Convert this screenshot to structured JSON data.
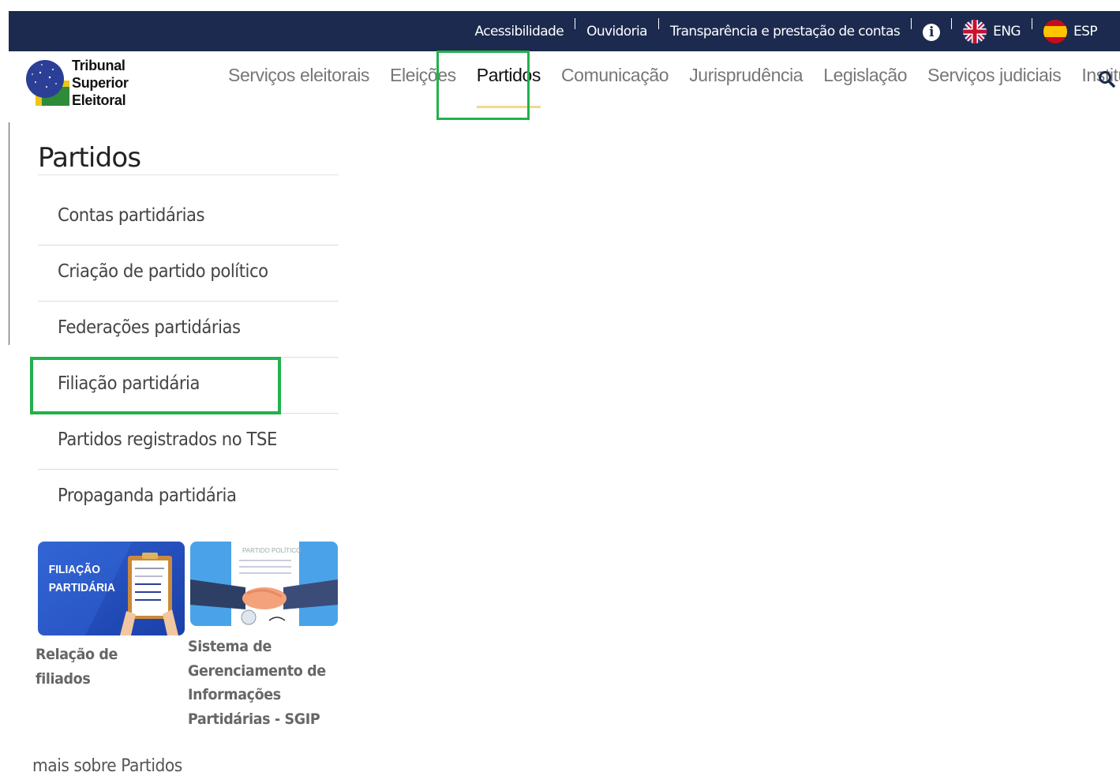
{
  "topbar": {
    "links": [
      "Acessibilidade",
      "Ouvidoria",
      "Transparência e prestação de contas"
    ],
    "info_icon": "info-icon",
    "languages": [
      {
        "label": "ENG",
        "icon": "uk-flag-icon"
      },
      {
        "label": "ESP",
        "icon": "spain-flag-icon"
      }
    ],
    "bg_color": "#1b2a4e"
  },
  "logo": {
    "lines": [
      "Tribunal",
      "Superior",
      "Eleitoral"
    ]
  },
  "nav": {
    "items": [
      {
        "label": "Serviços eleitorais"
      },
      {
        "label": "Eleições"
      },
      {
        "label": "Partidos",
        "active": true
      },
      {
        "label": "Comunicação"
      },
      {
        "label": "Jurisprudência"
      },
      {
        "label": "Legislação"
      },
      {
        "label": "Serviços judiciais"
      },
      {
        "label": "Institucional"
      }
    ],
    "search_icon": "search-icon",
    "active_underline_color": "#f2d98a"
  },
  "sidebar": {
    "title": "Partidos",
    "items": [
      {
        "label": "Contas partidárias"
      },
      {
        "label": "Criação de partido político"
      },
      {
        "label": "Federações partidárias"
      },
      {
        "label": "Filiação partidária",
        "highlighted": true
      },
      {
        "label": "Partidos registrados no TSE"
      },
      {
        "label": "Propaganda partidária"
      }
    ]
  },
  "cards": [
    {
      "image_text": [
        "FILIAÇÃO",
        "PARTIDÁRIA"
      ],
      "caption": [
        "Relação de filiados"
      ]
    },
    {
      "image_text": [
        "PARTIDO POLÍTICO"
      ],
      "caption": [
        "Sistema de",
        "Gerenciamento de",
        "Informações",
        "Partidárias - SGIP"
      ]
    }
  ],
  "more_link": "mais sobre Partidos",
  "highlight_color": "#22b14c"
}
